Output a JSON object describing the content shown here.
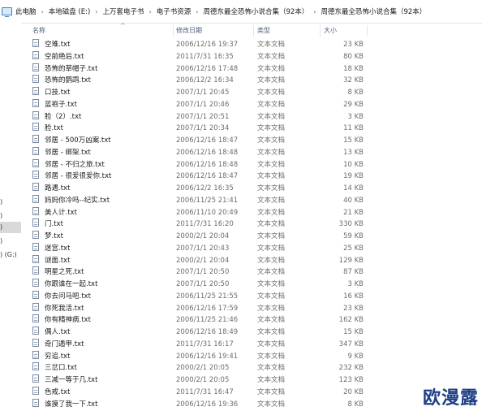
{
  "breadcrumb": {
    "items": [
      "此电脑",
      "本地磁盘 (E:)",
      "上万套电子书",
      "电子书资源",
      "周德东最全恐怖小说合集（92本）",
      "周德东最全恐怖小说合集（92本）"
    ],
    "separator": "›"
  },
  "sidebar": {
    "items": [
      ")",
      ")",
      ")",
      ")",
      ") (G:)"
    ]
  },
  "columns": {
    "name": "名称",
    "date": "修改日期",
    "type": "类型",
    "size": "大小",
    "sort_indicator": "^"
  },
  "files": [
    {
      "name": "空难.txt",
      "date": "2006/12/16 19:37",
      "type": "文本文档",
      "size": "23 KB"
    },
    {
      "name": "空前绝后.txt",
      "date": "2011/7/31 16:35",
      "type": "文本文档",
      "size": "80 KB"
    },
    {
      "name": "恐怖的草帽子.txt",
      "date": "2006/12/16 17:48",
      "type": "文本文档",
      "size": "18 KB"
    },
    {
      "name": "恐怖的鹦鹉.txt",
      "date": "2006/12/2 16:34",
      "type": "文本文档",
      "size": "32 KB"
    },
    {
      "name": "口技.txt",
      "date": "2007/1/1 20:45",
      "type": "文本文档",
      "size": "8 KB"
    },
    {
      "name": "蓝袍子.txt",
      "date": "2007/1/1 20:46",
      "type": "文本文档",
      "size": "29 KB"
    },
    {
      "name": "脸（2）.txt",
      "date": "2007/1/1 20:51",
      "type": "文本文档",
      "size": "3 KB"
    },
    {
      "name": "脸.txt",
      "date": "2007/1/1 20:34",
      "type": "文本文档",
      "size": "11 KB"
    },
    {
      "name": "邻居 - 500万凶案.txt",
      "date": "2006/12/16 18:47",
      "type": "文本文档",
      "size": "15 KB"
    },
    {
      "name": "邻居 - 绑架.txt",
      "date": "2006/12/16 18:48",
      "type": "文本文档",
      "size": "13 KB"
    },
    {
      "name": "邻居 - 不归之旅.txt",
      "date": "2006/12/16 18:48",
      "type": "文本文档",
      "size": "10 KB"
    },
    {
      "name": "邻居 - 很爱很爱你.txt",
      "date": "2006/12/16 18:47",
      "type": "文本文档",
      "size": "19 KB"
    },
    {
      "name": "路遇.txt",
      "date": "2006/12/2 16:35",
      "type": "文本文档",
      "size": "14 KB"
    },
    {
      "name": "妈妈你冷吗--纪实.txt",
      "date": "2006/11/25 21:41",
      "type": "文本文档",
      "size": "40 KB"
    },
    {
      "name": "美人计.txt",
      "date": "2006/11/10 20:49",
      "type": "文本文档",
      "size": "21 KB"
    },
    {
      "name": "门.txt",
      "date": "2011/7/31 16:20",
      "type": "文本文档",
      "size": "330 KB"
    },
    {
      "name": "梦.txt",
      "date": "2000/2/1 20:04",
      "type": "文本文档",
      "size": "59 KB"
    },
    {
      "name": "迷宫.txt",
      "date": "2007/1/1 20:43",
      "type": "文本文档",
      "size": "25 KB"
    },
    {
      "name": "谜面.txt",
      "date": "2000/2/1 20:04",
      "type": "文本文档",
      "size": "129 KB"
    },
    {
      "name": "明星之死.txt",
      "date": "2007/1/1 20:50",
      "type": "文本文档",
      "size": "87 KB"
    },
    {
      "name": "你跟谁在一起.txt",
      "date": "2007/1/1 20:50",
      "type": "文本文档",
      "size": "3 KB"
    },
    {
      "name": "你去问马吧.txt",
      "date": "2006/11/25 21:55",
      "type": "文本文档",
      "size": "16 KB"
    },
    {
      "name": "你死我活.txt",
      "date": "2006/12/16 17:59",
      "type": "文本文档",
      "size": "23 KB"
    },
    {
      "name": "你有精神病.txt",
      "date": "2006/11/25 21:46",
      "type": "文本文档",
      "size": "162 KB"
    },
    {
      "name": "偶人.txt",
      "date": "2006/12/16 18:49",
      "type": "文本文档",
      "size": "15 KB"
    },
    {
      "name": "奇门遁甲.txt",
      "date": "2011/7/31 16:17",
      "type": "文本文档",
      "size": "347 KB"
    },
    {
      "name": "穷追.txt",
      "date": "2006/12/16 19:41",
      "type": "文本文档",
      "size": "9 KB"
    },
    {
      "name": "三岔口.txt",
      "date": "2000/2/1 20:05",
      "type": "文本文档",
      "size": "232 KB"
    },
    {
      "name": "三减一等于几.txt",
      "date": "2000/2/1 20:05",
      "type": "文本文档",
      "size": "123 KB"
    },
    {
      "name": "色戒.txt",
      "date": "2011/7/31 16:47",
      "type": "文本文档",
      "size": "20 KB"
    },
    {
      "name": "谁摸了我一下.txt",
      "date": "2006/12/16 19:36",
      "type": "文本文档",
      "size": "8 KB"
    }
  ],
  "watermark": "欧漫露"
}
